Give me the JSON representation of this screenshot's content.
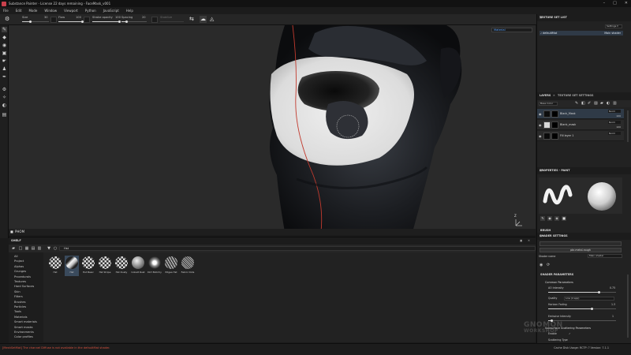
{
  "window": {
    "title": "Substance Painter - License 22 days remaining - FaceMask_v001",
    "controls": [
      "–",
      "□",
      "✕"
    ]
  },
  "menu": [
    "File",
    "Edit",
    "Mode",
    "Window",
    "Viewport",
    "Python",
    "JavaScript",
    "Help"
  ],
  "tool_options": {
    "size_label": "Size",
    "size_value": "30",
    "flow_label": "Flow",
    "flow_value": "100",
    "stroke_opacity_label": "Stroke opacity",
    "stroke_opacity_value": "100",
    "spacing_label": "Spacing",
    "spacing_value": "20",
    "stabilize_label": "Stabilize",
    "size_fraction": 0.3,
    "flow_fraction": 1.0,
    "stroke_opacity_fraction": 1.0,
    "spacing_fraction": 0.2
  },
  "viewport": {
    "mode": "Material",
    "bottom_label": "PHOM",
    "gizmo_label": "Z"
  },
  "shelf": {
    "title": "SHELF",
    "filter_text": "Hst",
    "categories": [
      "All",
      "Project",
      "Alphas",
      "Grunges",
      "Procedurals",
      "Textures",
      "Hard Surfaces",
      "Skin",
      "Filters",
      "Brushes",
      "Particles",
      "Tools",
      "Materials",
      "Smart materials",
      "Smart masks",
      "Environments",
      "Color profiles"
    ],
    "brushes": [
      {
        "label": "Hst",
        "style": "checker"
      },
      {
        "label": "Hst",
        "style": "stroke",
        "selected": true
      },
      {
        "label": "Hst Basic",
        "style": "checker"
      },
      {
        "label": "Hst Stripe",
        "style": "checker"
      },
      {
        "label": "Hst Dusty",
        "style": "checker"
      },
      {
        "label": "Cobalt Rust",
        "style": "sphere"
      },
      {
        "label": "Dirt Blotchy",
        "style": "splat"
      },
      {
        "label": "Edges Hst",
        "style": "scratch"
      },
      {
        "label": "Fabric Dots",
        "style": "hatch"
      }
    ]
  },
  "texture_set_list": {
    "title": "TEXTURE SET LIST",
    "settings_btn": "Settings ▾",
    "item_name": "defaultMat",
    "item_shader": "Main shader"
  },
  "layers": {
    "tab_layers": "LAYERS",
    "tab_tss": "TEXTURE SET SETTINGS",
    "blend_mode": "Base Color",
    "rows": [
      {
        "name": "Black_Mask",
        "blend": "Norm",
        "opacity": "100",
        "thumb": "#0d0d0d",
        "selected": true
      },
      {
        "name": "Blank_mask",
        "blend": "Norm",
        "opacity": "100",
        "thumb": "#d8d8d8",
        "selected": false
      },
      {
        "name": "Fill layer 1",
        "blend": "Norm",
        "opacity": "",
        "thumb": "#0a0a0a",
        "selected": false
      }
    ]
  },
  "properties": {
    "title": "PROPERTIES - PAINT",
    "brush_label": "BRUSH",
    "size_label": "Size"
  },
  "shader_settings": {
    "title": "SHADER SETTINGS",
    "btn": "pbr-metal-rough",
    "shader_name_label": "Shader name",
    "shader_name_value": "Main shader",
    "params_label": "SHADER PARAMETERS",
    "common_label": "Common Parameters",
    "ao_label": "AO Intensity",
    "ao_value": "0.75",
    "ao_fraction": 0.75,
    "quality_label": "Quality",
    "quality_value": "Low (4 spp)",
    "horizon_label": "Horizon Fading",
    "horizon_value": "1.3",
    "horizon_fraction": 0.65,
    "emissive_label": "Emissive Intensity",
    "emissive_value": "1",
    "emissive_fraction": 0.05,
    "sss_label": "Subsurface Scattering Parameters",
    "enable_label": "Enable",
    "scatter_label": "Scattering Type"
  },
  "status": {
    "message": "[MeshSetMat] The channel Diffuse is not available in the defaultMat shader.",
    "right": "Cache Disk Usage:   RCTP: ?   Version: 7.1.1"
  },
  "watermark": {
    "line1": "GNOMON",
    "line2": "WORKSHOP"
  },
  "colors": {
    "accent": "#5aa3ff",
    "error": "#d9523f",
    "selected_row": "#2f3a47",
    "seam": "#c23a2e"
  }
}
